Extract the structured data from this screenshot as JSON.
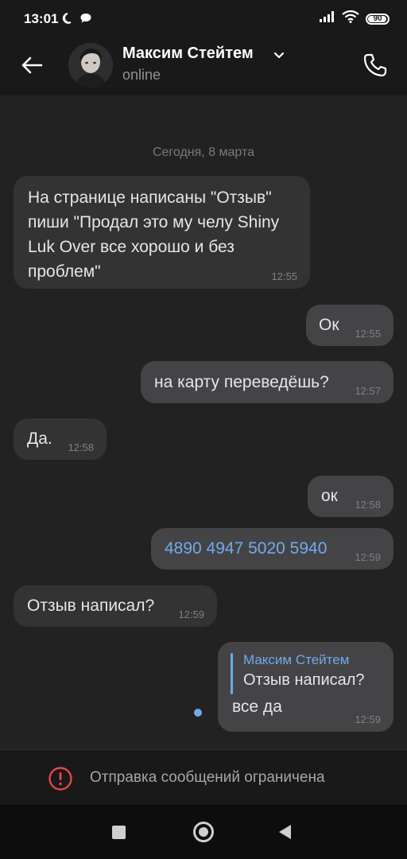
{
  "status_bar": {
    "time": "13:01",
    "battery": "90"
  },
  "header": {
    "name": "Максим Стейтем",
    "status": "online"
  },
  "chat": {
    "date_separator": "Сегодня, 8 марта",
    "messages": [
      {
        "direction": "in",
        "text": "На странице написаны \"Отзыв\"\nпиши \"Продал это му челу Shiny\nLuk Over все хорошо и без\nпроблем\"",
        "time": "12:55"
      },
      {
        "direction": "out",
        "text": "Ок",
        "time": "12:55"
      },
      {
        "direction": "out",
        "text": "на карту переведёшь?",
        "time": "12:57"
      },
      {
        "direction": "in",
        "text": "Да.",
        "time": "12:58"
      },
      {
        "direction": "out",
        "text": "ок",
        "time": "12:58"
      },
      {
        "direction": "out",
        "text": "4890 4947 5020 5940",
        "time": "12:59"
      },
      {
        "direction": "in",
        "text": "Отзыв написал?",
        "time": "12:59"
      },
      {
        "direction": "out",
        "reply_author": "Максим Стейтем",
        "reply_text": "Отзыв написал?",
        "text": "все да",
        "time": "12:59"
      }
    ]
  },
  "restricted": {
    "text": "Отправка сообщений ограничена"
  },
  "colors": {
    "accent": "#71aaeb",
    "warning": "#e64646"
  }
}
